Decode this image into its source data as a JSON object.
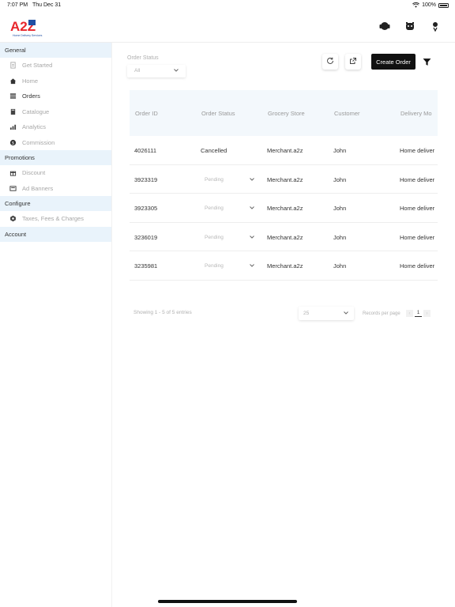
{
  "statusbar": {
    "time": "7:07 PM",
    "date": "Thu Dec 31",
    "battery": "100%"
  },
  "logo": {
    "mark": "A2Z",
    "tagline": "Home Delivery Services"
  },
  "sidebar": {
    "sections": [
      {
        "title": "General",
        "items": [
          {
            "label": "Get Started",
            "icon": "doc-icon",
            "active": false
          },
          {
            "label": "Home",
            "icon": "home-icon",
            "active": true
          },
          {
            "label": "Orders",
            "icon": "list-icon",
            "active": true
          },
          {
            "label": "Catalogue",
            "icon": "book-icon",
            "active": false
          },
          {
            "label": "Analytics",
            "icon": "chart-icon",
            "active": false
          },
          {
            "label": "Commission",
            "icon": "dollar-icon",
            "active": false
          }
        ]
      },
      {
        "title": "Promotions",
        "items": [
          {
            "label": "Discount",
            "icon": "gift-icon",
            "active": false
          },
          {
            "label": "Ad Banners",
            "icon": "banner-icon",
            "active": true
          }
        ]
      },
      {
        "title": "Configure",
        "items": [
          {
            "label": "Taxes, Fees & Charges",
            "icon": "hexagon-icon",
            "active": false
          }
        ]
      },
      {
        "title": "Account",
        "items": []
      }
    ]
  },
  "toolbar": {
    "status_label": "Order Status",
    "status_value": "All",
    "create_label": "Create Order"
  },
  "table": {
    "columns": [
      "Order ID",
      "Order Status",
      "Grocery Store",
      "Customer",
      "Delivery Mo"
    ],
    "rows": [
      {
        "id": "4026111",
        "status": "Cancelled",
        "store": "Merchant.a2z",
        "customer": "John",
        "delivery": "Home deliver"
      },
      {
        "id": "3923319",
        "status": "Pending",
        "store": "Merchant.a2z",
        "customer": "John",
        "delivery": "Home deliver"
      },
      {
        "id": "3923305",
        "status": "Pending",
        "store": "Merchant.a2z",
        "customer": "John",
        "delivery": "Home deliver"
      },
      {
        "id": "3236019",
        "status": "Pending",
        "store": "Merchant.a2z",
        "customer": "John",
        "delivery": "Home deliver"
      },
      {
        "id": "3235981",
        "status": "Pending",
        "store": "Merchant.a2z",
        "customer": "John",
        "delivery": "Home deliver"
      }
    ]
  },
  "footer": {
    "showing": "Showing 1 - 5 of 5 entries",
    "per_page_value": "25",
    "per_page_label": "Records per page",
    "prev": "‹",
    "page": "1",
    "next": "›"
  },
  "colors": {
    "section_bg": "#e9f3fb",
    "header_bg": "#f3f8fc",
    "logo_red": "#e8262c",
    "logo_blue": "#1f4fa3"
  }
}
